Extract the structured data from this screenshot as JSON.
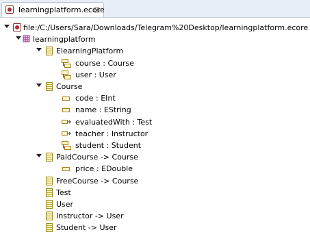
{
  "editor": {
    "tab_label": "learningplatform.ecore",
    "tab_close_glyph": "⊠"
  },
  "tree": {
    "resource": "file:/C:/Users/Sara/Downloads/Telegram%20Desktop/learningplatform.ecore",
    "package": "learningplatform",
    "classes": [
      {
        "label": "ElearningPlatform",
        "features": [
          {
            "label": "course : Course",
            "kind": "containment"
          },
          {
            "label": "user : User",
            "kind": "containment"
          }
        ]
      },
      {
        "label": "Course",
        "features": [
          {
            "label": "code : EInt",
            "kind": "attribute"
          },
          {
            "label": "name : EString",
            "kind": "attribute"
          },
          {
            "label": "evaluatedWith : Test",
            "kind": "reference"
          },
          {
            "label": "teacher : Instructor",
            "kind": "reference"
          },
          {
            "label": "student : Student",
            "kind": "containment"
          }
        ]
      },
      {
        "label": "PaidCourse -> Course",
        "features": [
          {
            "label": "price : EDouble",
            "kind": "attribute"
          }
        ]
      },
      {
        "label": "FreeCourse -> Course",
        "features": []
      },
      {
        "label": "Test",
        "features": []
      },
      {
        "label": "User",
        "features": []
      },
      {
        "label": "Instructor -> User",
        "features": []
      },
      {
        "label": "Student -> User",
        "features": []
      }
    ]
  },
  "colors": {
    "tab_bar_bg": "#e7eef8",
    "class_icon": "#b9a33a",
    "package_icon": "#9b2d8e",
    "resource_icon": "#b02a3b"
  }
}
